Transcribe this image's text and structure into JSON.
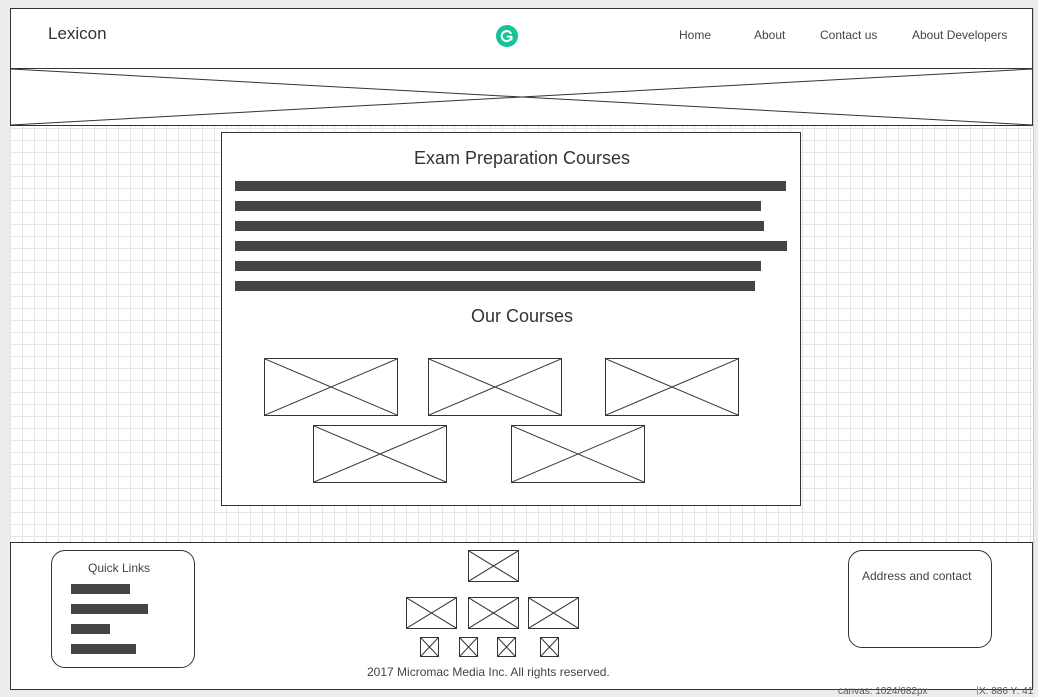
{
  "header": {
    "brand": "Lexicon",
    "nav": [
      {
        "label": "Home"
      },
      {
        "label": "About"
      },
      {
        "label": "Contact us"
      },
      {
        "label": "About Developers"
      }
    ]
  },
  "main": {
    "title": "Exam Preparation Courses",
    "courses_title": "Our Courses"
  },
  "footer": {
    "quick_links_title": "Quick Links",
    "address_title": "Address and contact",
    "copyright": "2017 Micromac Media Inc. All rights reserved."
  },
  "status_bar": {
    "canvas": "canvas: 1024/682px",
    "coords": "X: 886 Y: 41"
  },
  "colors": {
    "logo_green": "#15c39a",
    "text_line": "#444444",
    "grid": "#e6e6e6"
  }
}
